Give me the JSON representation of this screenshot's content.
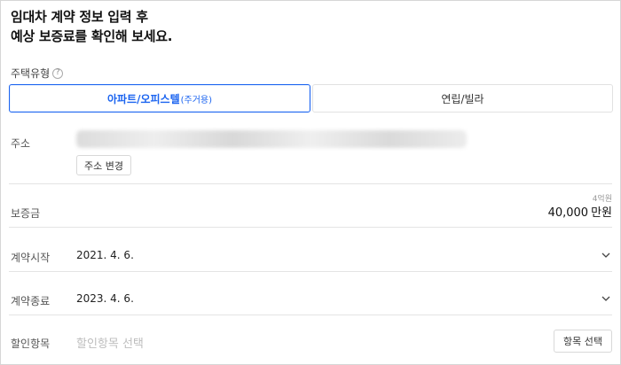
{
  "headline": {
    "line1": "임대차 계약 정보 입력 후",
    "line2": "예상 보증료를 확인해 보세요."
  },
  "housing_type": {
    "label": "주택유형",
    "help_icon": "question-circle-icon",
    "options": [
      {
        "label": "아파트/오피스텔",
        "sub": "(주거용)",
        "selected": true
      },
      {
        "label": "연립/빌라",
        "sub": "",
        "selected": false
      }
    ]
  },
  "address": {
    "label": "주소",
    "change_button": "주소 변경"
  },
  "deposit": {
    "label": "보증금",
    "hint": "4억원",
    "value": "40,000",
    "unit": "만원"
  },
  "contract_start": {
    "label": "계약시작",
    "value": "2021. 4. 6."
  },
  "contract_end": {
    "label": "계약종료",
    "value": "2023. 4. 6."
  },
  "discount": {
    "label": "할인항목",
    "placeholder": "할인항목 선택",
    "select_button": "항목 선택"
  },
  "colors": {
    "accent": "#1b64f0",
    "border": "#d8d8d8",
    "placeholder": "#bdbdbd"
  }
}
